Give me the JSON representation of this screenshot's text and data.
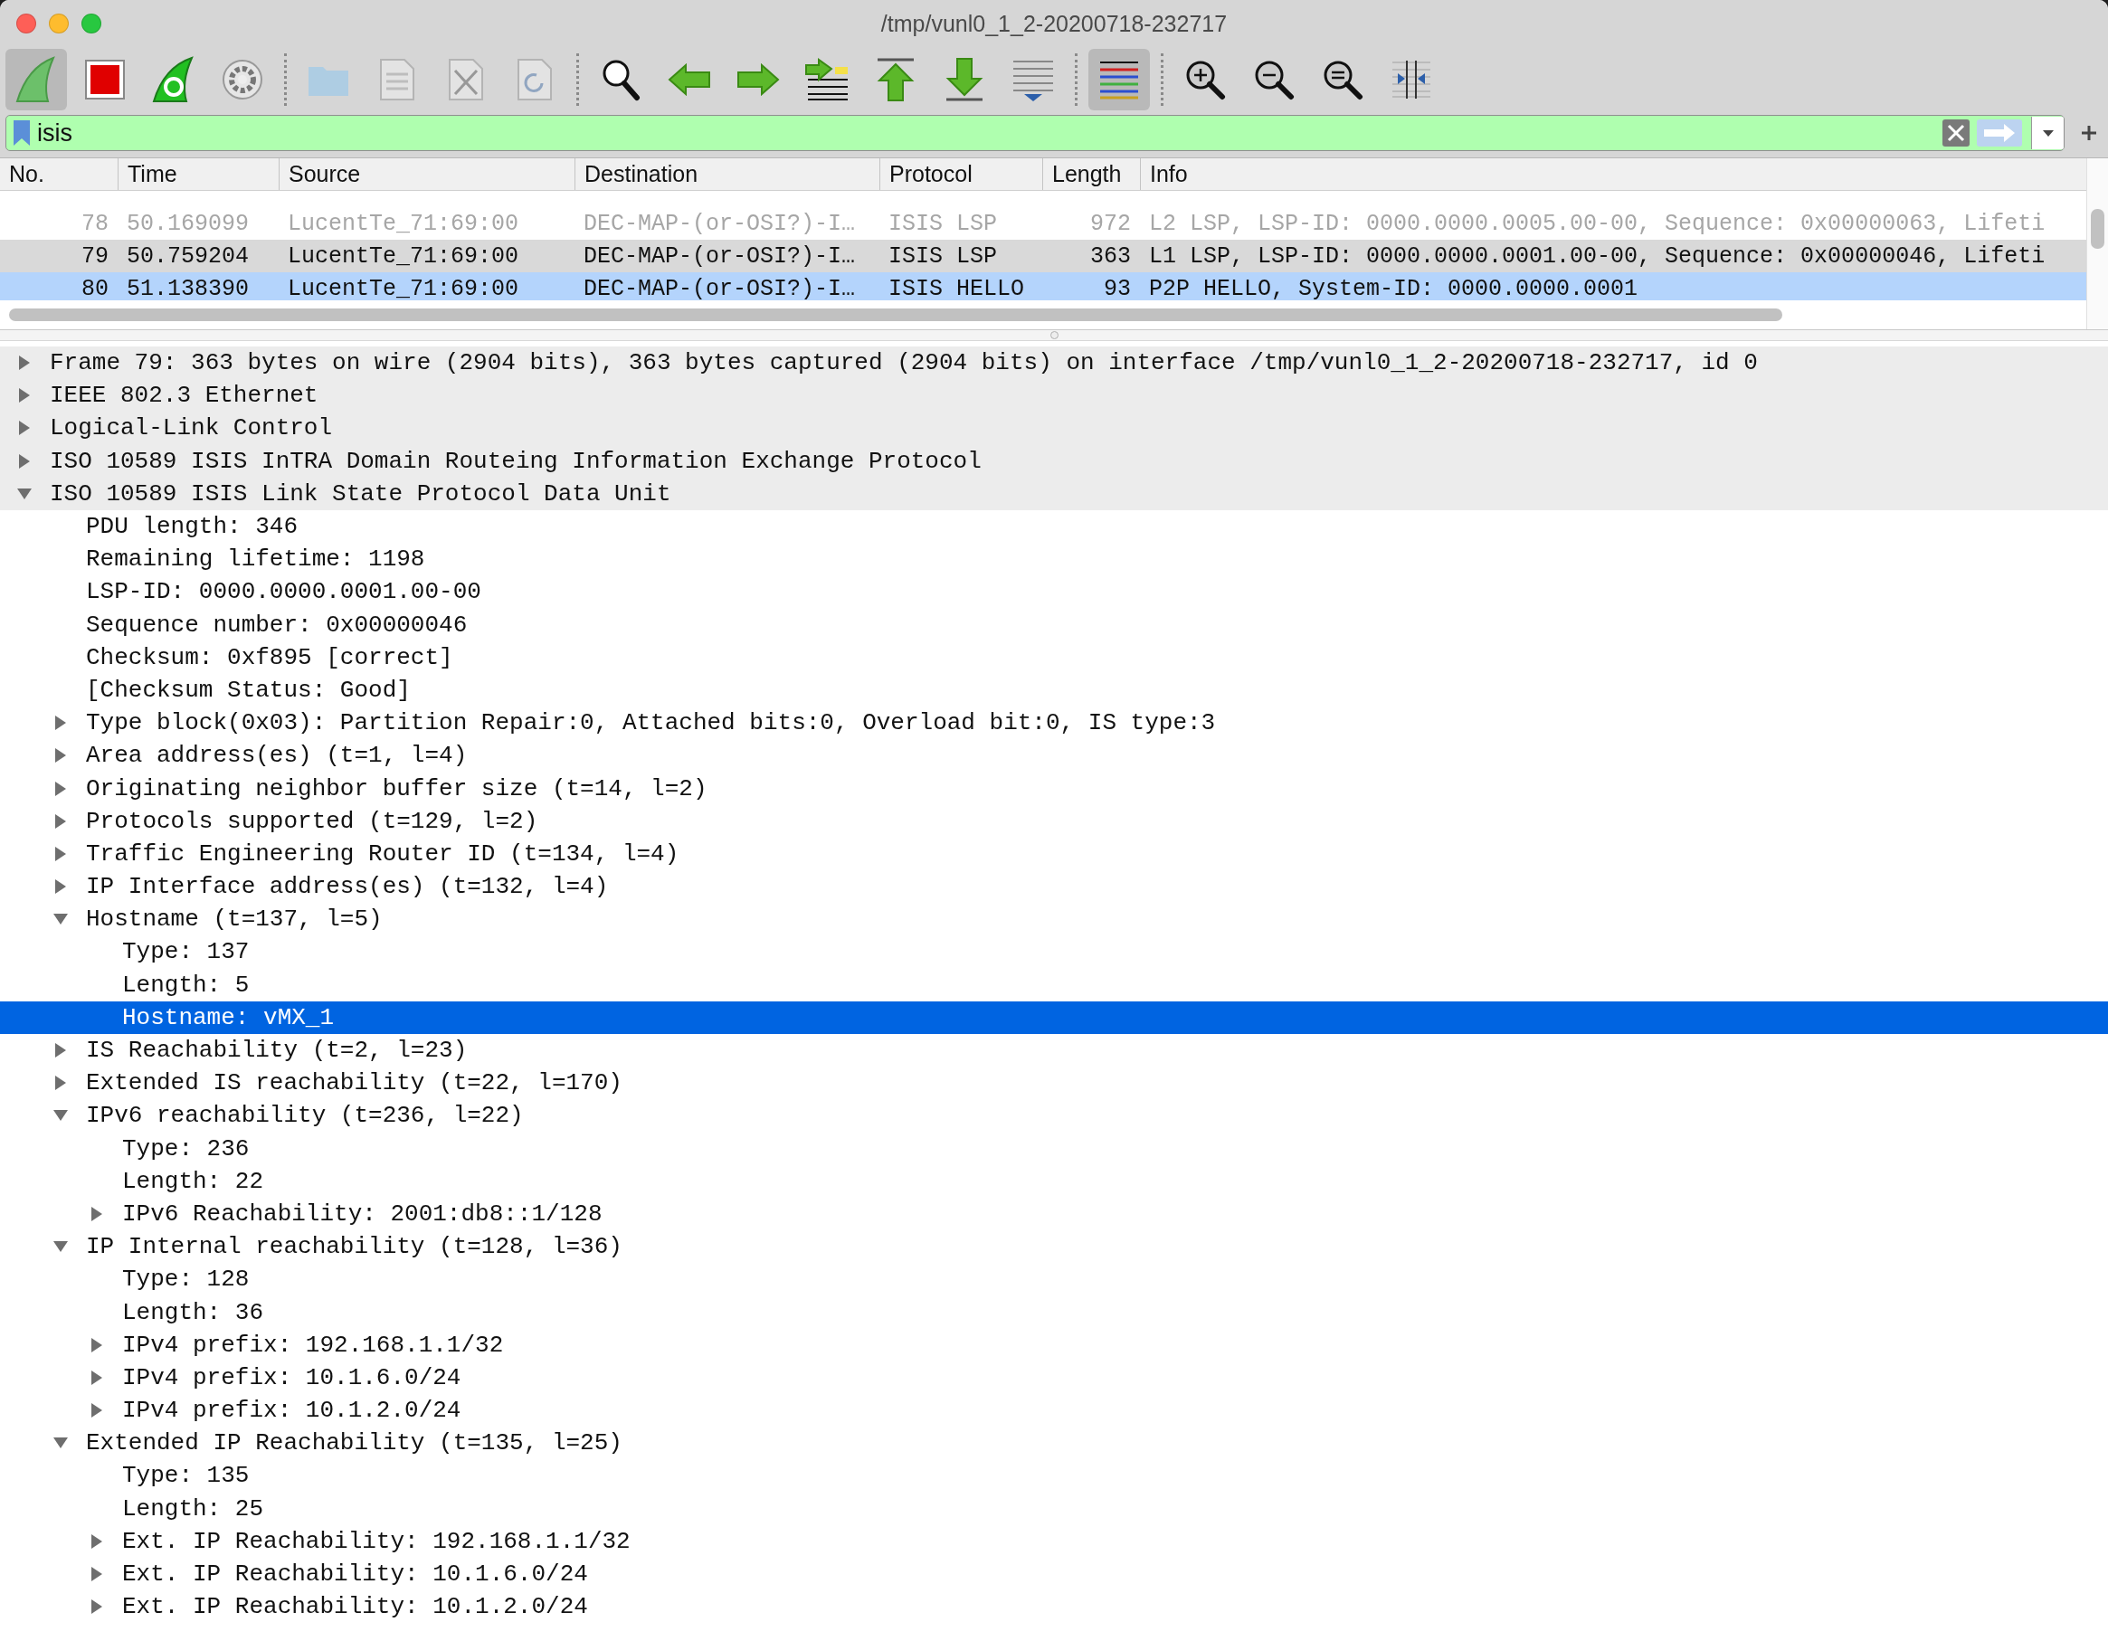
{
  "window": {
    "title": "/tmp/vunl0_1_2-20200718-232717"
  },
  "toolbar": [
    {
      "kind": "start",
      "pressed": true,
      "disabled": false
    },
    {
      "kind": "stop",
      "pressed": false,
      "disabled": false
    },
    {
      "kind": "restart",
      "pressed": false,
      "disabled": false
    },
    {
      "kind": "options",
      "pressed": false,
      "disabled": false
    },
    {
      "kind": "separator"
    },
    {
      "kind": "open",
      "pressed": false,
      "disabled": true
    },
    {
      "kind": "save",
      "pressed": false,
      "disabled": true
    },
    {
      "kind": "close",
      "pressed": false,
      "disabled": true
    },
    {
      "kind": "reload",
      "pressed": false,
      "disabled": true
    },
    {
      "kind": "separator"
    },
    {
      "kind": "find",
      "pressed": false,
      "disabled": false
    },
    {
      "kind": "back",
      "pressed": false,
      "disabled": false
    },
    {
      "kind": "forward",
      "pressed": false,
      "disabled": false
    },
    {
      "kind": "goto",
      "pressed": false,
      "disabled": false
    },
    {
      "kind": "first",
      "pressed": false,
      "disabled": false
    },
    {
      "kind": "last",
      "pressed": false,
      "disabled": false
    },
    {
      "kind": "autoscroll",
      "pressed": false,
      "disabled": false
    },
    {
      "kind": "separator"
    },
    {
      "kind": "colorize",
      "pressed": true,
      "disabled": false
    },
    {
      "kind": "separator"
    },
    {
      "kind": "zoomin",
      "pressed": false,
      "disabled": false
    },
    {
      "kind": "zoomout",
      "pressed": false,
      "disabled": false
    },
    {
      "kind": "zoomreset",
      "pressed": false,
      "disabled": false
    },
    {
      "kind": "resize",
      "pressed": false,
      "disabled": false
    }
  ],
  "filter": {
    "value": "isis"
  },
  "packet_list": {
    "columns": [
      "No.",
      "Time",
      "Source",
      "Destination",
      "Protocol",
      "Length",
      "Info"
    ],
    "rows": [
      {
        "cells": [
          "78",
          "50.169099",
          "LucentTe_71:69:00",
          "DEC-MAP-(or-OSI?)-I…",
          "ISIS LSP",
          "972",
          "L2 LSP, LSP-ID: 0000.0000.0005.00-00, Sequence: 0x00000063, Lifeti"
        ],
        "dimmed": true,
        "color": "#ffffff"
      },
      {
        "cells": [
          "79",
          "50.759204",
          "LucentTe_71:69:00",
          "DEC-MAP-(or-OSI?)-I…",
          "ISIS LSP",
          "363",
          "L1 LSP, LSP-ID: 0000.0000.0001.00-00, Sequence: 0x00000046, Lifeti"
        ],
        "dimmed": false,
        "color": "#d9d9d9"
      },
      {
        "cells": [
          "80",
          "51.138390",
          "LucentTe_71:69:00",
          "DEC-MAP-(or-OSI?)-I…",
          "ISIS HELLO",
          "93",
          "P2P HELLO, System-ID: 0000.0000.0001"
        ],
        "dimmed": false,
        "color": "#b4d4fc"
      }
    ]
  },
  "details": [
    {
      "label": "Frame 79: 363 bytes on wire (2904 bits), 363 bytes captured (2904 bits) on interface /tmp/vunl0_1_2-20200718-232717, id 0",
      "expanded": false,
      "selected": false
    },
    {
      "label": "IEEE 802.3 Ethernet",
      "expanded": false,
      "selected": false
    },
    {
      "label": "Logical-Link Control",
      "expanded": false,
      "selected": false
    },
    {
      "label": "ISO 10589 ISIS InTRA Domain Routeing Information Exchange Protocol",
      "expanded": false,
      "selected": false
    },
    {
      "label": "ISO 10589 ISIS Link State Protocol Data Unit",
      "expanded": true,
      "selected": false,
      "children": [
        {
          "label": "PDU length: 346",
          "selected": false
        },
        {
          "label": "Remaining lifetime: 1198",
          "selected": false
        },
        {
          "label": "LSP-ID: 0000.0000.0001.00-00",
          "selected": false
        },
        {
          "label": "Sequence number: 0x00000046",
          "selected": false
        },
        {
          "label": "Checksum: 0xf895 [correct]",
          "selected": false
        },
        {
          "label": "[Checksum Status: Good]",
          "selected": false
        },
        {
          "label": "Type block(0x03): Partition Repair:0, Attached bits:0, Overload bit:0, IS type:3",
          "expanded": false,
          "selected": false
        },
        {
          "label": "Area address(es) (t=1, l=4)",
          "expanded": false,
          "selected": false
        },
        {
          "label": "Originating neighbor buffer size (t=14, l=2)",
          "expanded": false,
          "selected": false
        },
        {
          "label": "Protocols supported (t=129, l=2)",
          "expanded": false,
          "selected": false
        },
        {
          "label": "Traffic Engineering Router ID (t=134, l=4)",
          "expanded": false,
          "selected": false
        },
        {
          "label": "IP Interface address(es) (t=132, l=4)",
          "expanded": false,
          "selected": false
        },
        {
          "label": "Hostname (t=137, l=5)",
          "expanded": true,
          "selected": false,
          "children": [
            {
              "label": "Type: 137",
              "selected": false
            },
            {
              "label": "Length: 5",
              "selected": false
            },
            {
              "label": "Hostname: vMX_1",
              "selected": true
            }
          ]
        },
        {
          "label": "IS Reachability (t=2, l=23)",
          "expanded": false,
          "selected": false
        },
        {
          "label": "Extended IS reachability (t=22, l=170)",
          "expanded": false,
          "selected": false
        },
        {
          "label": "IPv6 reachability (t=236, l=22)",
          "expanded": true,
          "selected": false,
          "children": [
            {
              "label": "Type: 236",
              "selected": false
            },
            {
              "label": "Length: 22",
              "selected": false
            },
            {
              "label": "IPv6 Reachability: 2001:db8::1/128",
              "expanded": false,
              "selected": false
            }
          ]
        },
        {
          "label": "IP Internal reachability (t=128, l=36)",
          "expanded": true,
          "selected": false,
          "children": [
            {
              "label": "Type: 128",
              "selected": false
            },
            {
              "label": "Length: 36",
              "selected": false
            },
            {
              "label": "IPv4 prefix: 192.168.1.1/32",
              "expanded": false,
              "selected": false
            },
            {
              "label": "IPv4 prefix: 10.1.6.0/24",
              "expanded": false,
              "selected": false
            },
            {
              "label": "IPv4 prefix: 10.1.2.0/24",
              "expanded": false,
              "selected": false
            }
          ]
        },
        {
          "label": "Extended IP Reachability (t=135, l=25)",
          "expanded": true,
          "selected": false,
          "children": [
            {
              "label": "Type: 135",
              "selected": false
            },
            {
              "label": "Length: 25",
              "selected": false
            },
            {
              "label": "Ext. IP Reachability: 192.168.1.1/32",
              "expanded": false,
              "selected": false
            },
            {
              "label": "Ext. IP Reachability: 10.1.6.0/24",
              "expanded": false,
              "selected": false
            },
            {
              "label": "Ext. IP Reachability: 10.1.2.0/24",
              "expanded": false,
              "selected": false
            }
          ]
        }
      ]
    }
  ]
}
